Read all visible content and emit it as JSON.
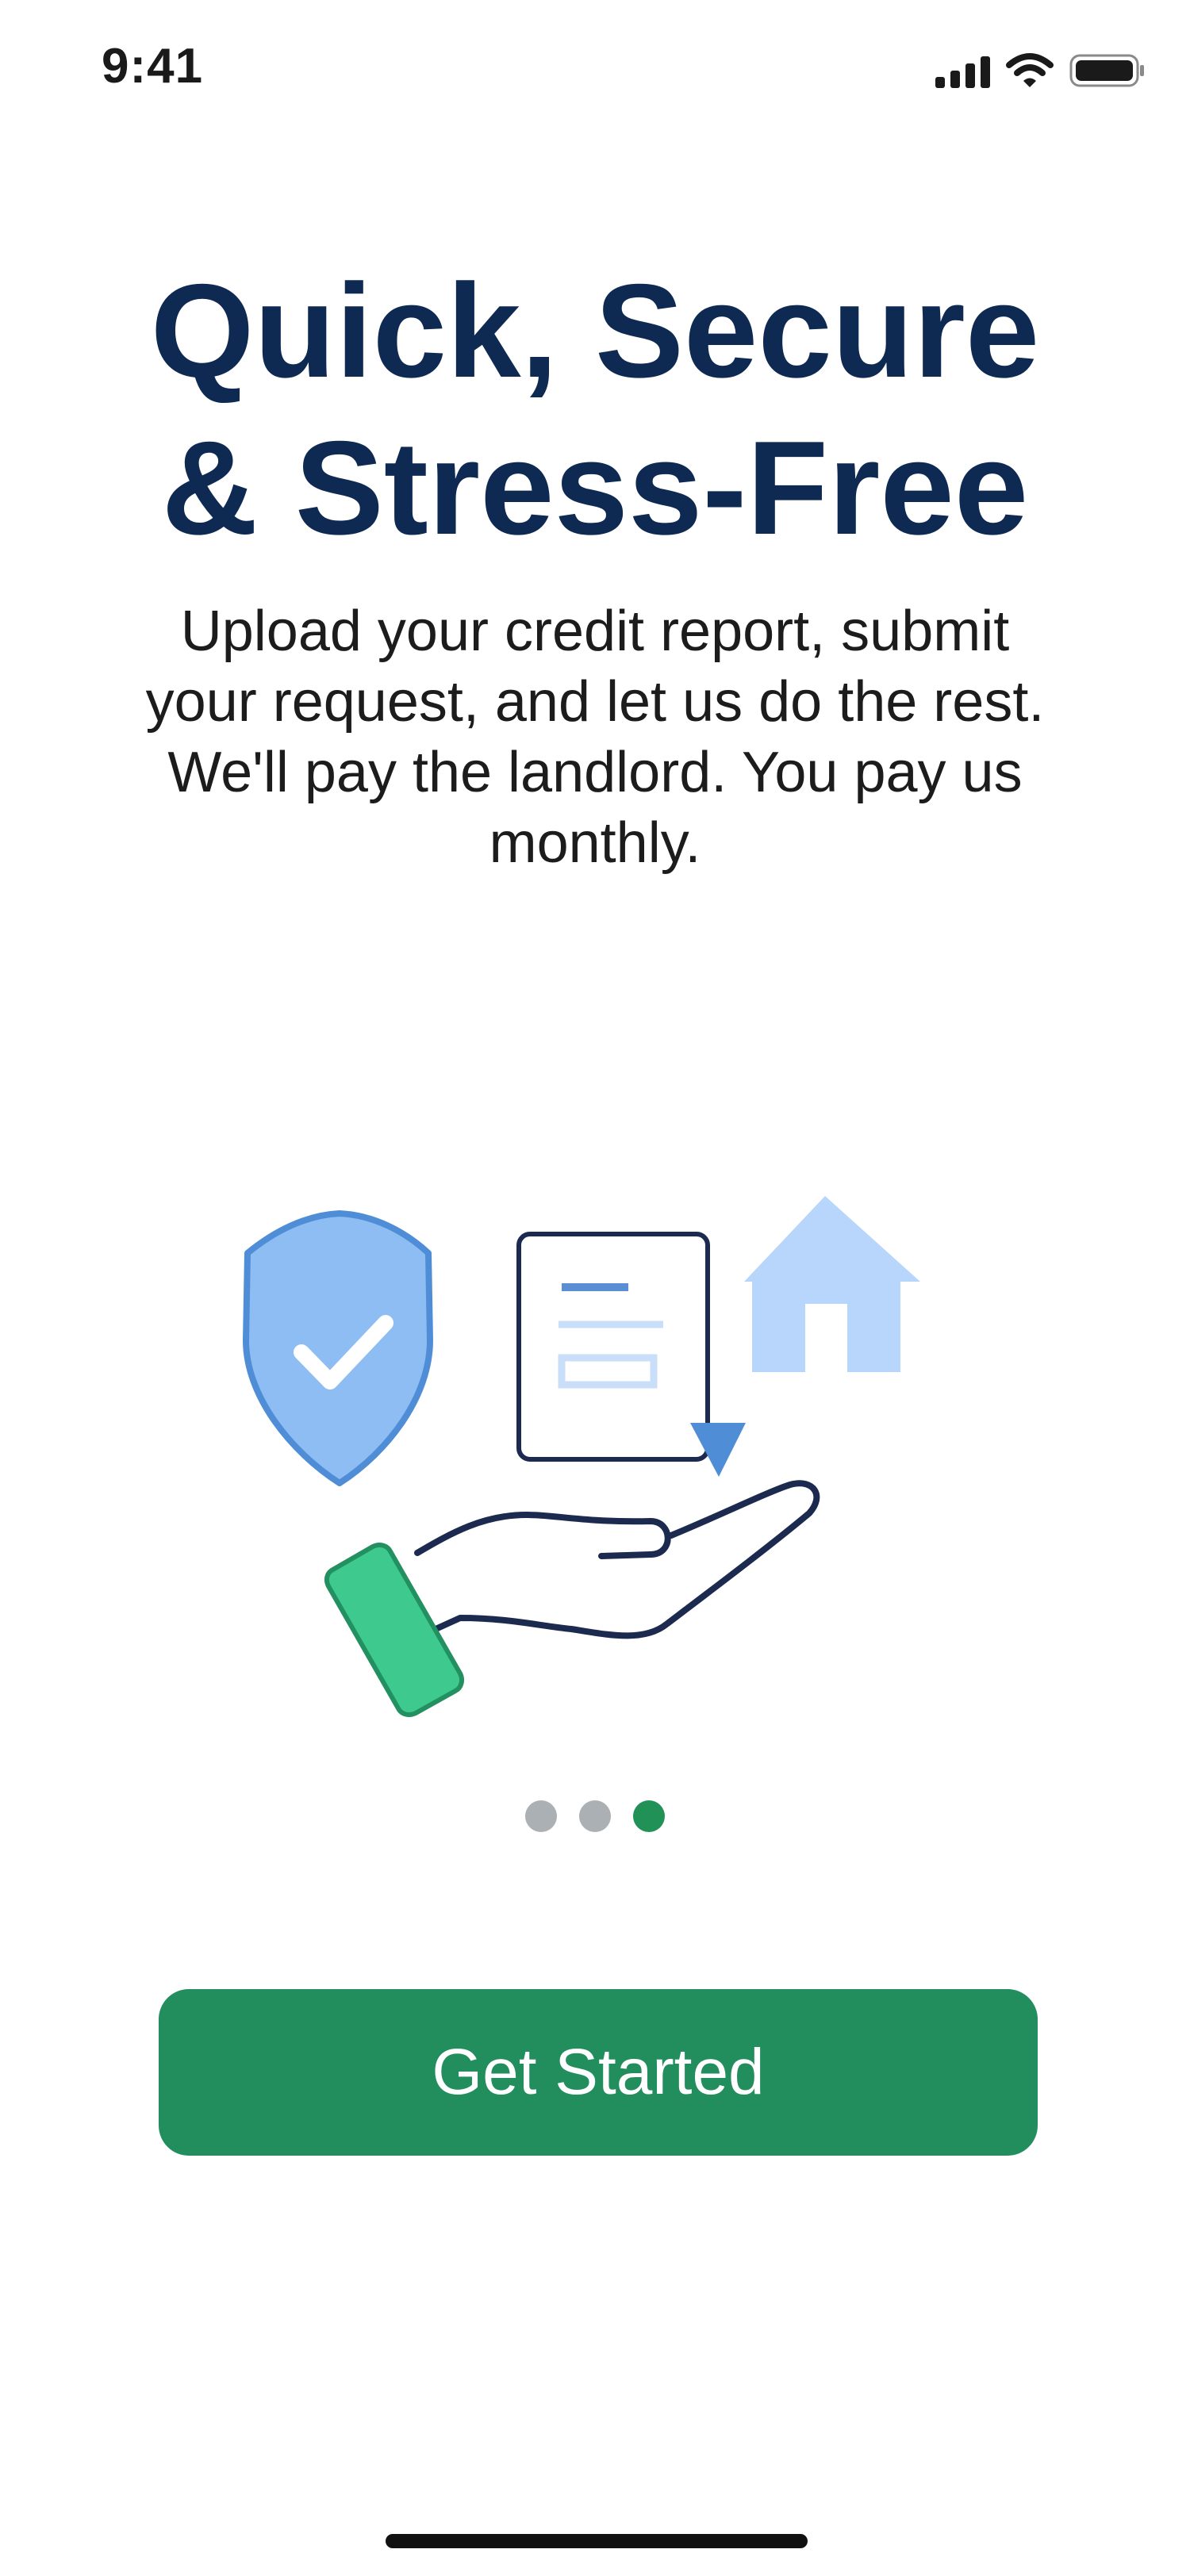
{
  "status_bar": {
    "time": "9:41",
    "icons": [
      "cellular-signal-icon",
      "wifi-icon",
      "battery-icon"
    ]
  },
  "onboarding": {
    "title_line1": "Quick, Secure",
    "title_line2": "& Stress-Free",
    "description": "Upload your credit report, submit your request, and let us do the rest. We'll pay the landlord. You pay us monthly.",
    "illustration_icons": [
      "shield-check-icon",
      "document-icon",
      "house-icon",
      "hand-icon"
    ],
    "pager": {
      "total": 3,
      "active_index": 2
    },
    "cta_label": "Get Started"
  },
  "colors": {
    "title": "#0e2a52",
    "accent_green": "#238e5d",
    "dot_inactive": "#abb0b5",
    "shield_blue": "#8dbdf3",
    "house_blue": "#b8d6fb"
  }
}
